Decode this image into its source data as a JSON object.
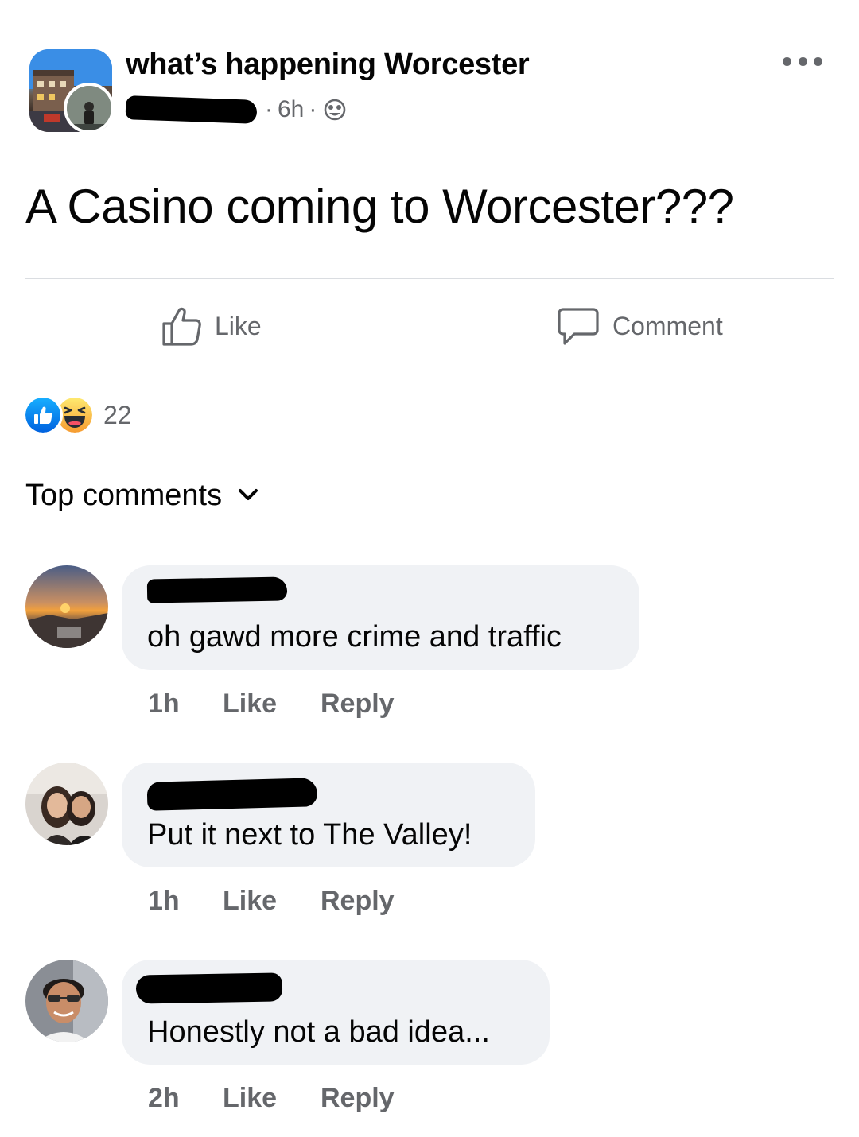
{
  "post": {
    "group_name": "what’s happening Worcester",
    "time": "6h",
    "dot_separator": "·",
    "text": "A Casino coming to Worcester???",
    "audience_icon": "globe-icon",
    "more_icon": "more-options-icon"
  },
  "actions": {
    "like_label": "Like",
    "comment_label": "Comment"
  },
  "reactions": {
    "types": [
      "like",
      "haha"
    ],
    "count": "22"
  },
  "comments_header": {
    "label": "Top comments"
  },
  "comments": [
    {
      "text": "oh gawd more crime and traffic",
      "time": "1h",
      "like_label": "Like",
      "reply_label": "Reply"
    },
    {
      "text": "Put it next to The Valley!",
      "time": "1h",
      "like_label": "Like",
      "reply_label": "Reply"
    },
    {
      "text": "Honestly not a bad idea...",
      "time": "2h",
      "like_label": "Like",
      "reply_label": "Reply"
    }
  ],
  "colors": {
    "text_primary": "#050505",
    "text_secondary": "#65676b",
    "bubble_bg": "#f0f2f5",
    "like_blue": "#1877f2",
    "haha_yellow": "#f7c64a"
  }
}
